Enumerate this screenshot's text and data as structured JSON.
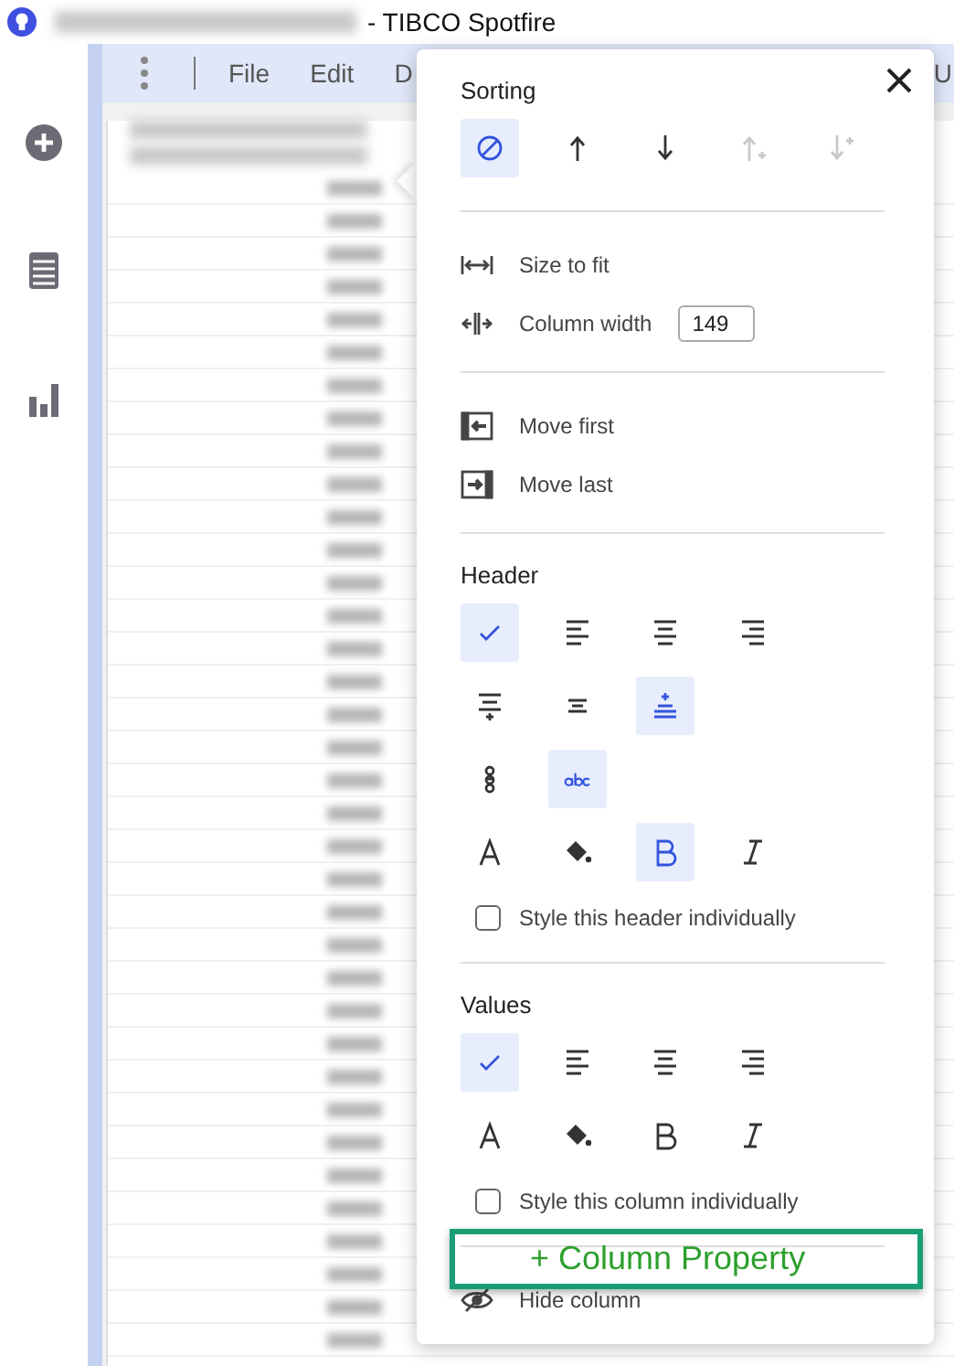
{
  "window": {
    "title": "- TIBCO Spotfire"
  },
  "menu": [
    {
      "label": "File"
    },
    {
      "label": "Edit"
    },
    {
      "label": "D"
    },
    {
      "label": "U"
    }
  ],
  "sidebar": [
    {
      "kind": "add"
    },
    {
      "kind": "table"
    },
    {
      "kind": "chart"
    }
  ],
  "popup": {
    "sections": [
      {
        "heading": "Sorting",
        "rows": [
          {
            "kind": "icons",
            "buttons": [
              {
                "kind": "no-sort",
                "selected": true,
                "disabled": false
              },
              {
                "kind": "sort-up",
                "selected": false,
                "disabled": false
              },
              {
                "kind": "sort-down",
                "selected": false,
                "disabled": false
              },
              {
                "kind": "add-up",
                "selected": false,
                "disabled": true
              },
              {
                "kind": "add-down",
                "selected": false,
                "disabled": true
              }
            ]
          }
        ]
      },
      {
        "rows": [
          {
            "kind": "fit",
            "label": "Size to fit"
          },
          {
            "kind": "width",
            "label": "Column width",
            "value": "149"
          }
        ]
      },
      {
        "rows": [
          {
            "kind": "first",
            "label": "Move first"
          },
          {
            "kind": "last",
            "label": "Move last"
          }
        ]
      },
      {
        "heading": "Header",
        "rows": [
          {
            "kind": "icons",
            "buttons": [
              {
                "kind": "auto",
                "selected": true,
                "disabled": false
              },
              {
                "kind": "left",
                "selected": false,
                "disabled": false
              },
              {
                "kind": "center",
                "selected": false,
                "disabled": false
              },
              {
                "kind": "right",
                "selected": false,
                "disabled": false
              }
            ]
          },
          {
            "kind": "icons",
            "buttons": [
              {
                "kind": "top",
                "selected": false,
                "disabled": false
              },
              {
                "kind": "middle",
                "selected": false,
                "disabled": false
              },
              {
                "kind": "bottom",
                "selected": true,
                "disabled": false
              }
            ]
          },
          {
            "kind": "icons",
            "buttons": [
              {
                "kind": "vertical-text",
                "selected": false,
                "disabled": false
              },
              {
                "kind": "horizontal-text",
                "selected": true,
                "disabled": false
              }
            ]
          },
          {
            "kind": "icons",
            "buttons": [
              {
                "kind": "font-color",
                "selected": false,
                "disabled": false
              },
              {
                "kind": "fill",
                "selected": false,
                "disabled": false
              },
              {
                "kind": "bold",
                "selected": true,
                "disabled": false
              },
              {
                "kind": "italic",
                "selected": false,
                "disabled": false
              }
            ]
          },
          {
            "kind": "checkbox",
            "label": "Style this header individually",
            "checked": false
          }
        ]
      },
      {
        "heading": "Values",
        "rows": [
          {
            "kind": "icons",
            "buttons": [
              {
                "kind": "auto",
                "selected": true,
                "disabled": false
              },
              {
                "kind": "left",
                "selected": false,
                "disabled": false
              },
              {
                "kind": "center",
                "selected": false,
                "disabled": false
              },
              {
                "kind": "right",
                "selected": false,
                "disabled": false
              }
            ]
          },
          {
            "kind": "icons",
            "buttons": [
              {
                "kind": "font-color",
                "selected": false,
                "disabled": false
              },
              {
                "kind": "fill",
                "selected": false,
                "disabled": false
              },
              {
                "kind": "bold",
                "selected": false,
                "disabled": false
              },
              {
                "kind": "italic",
                "selected": false,
                "disabled": false
              }
            ]
          },
          {
            "kind": "checkbox",
            "label": "Style this column individually",
            "checked": false
          }
        ]
      },
      {
        "rows": [
          {
            "kind": "hide",
            "label": "Hide column"
          }
        ]
      }
    ]
  },
  "callout": {
    "label": "+ Column Property"
  }
}
